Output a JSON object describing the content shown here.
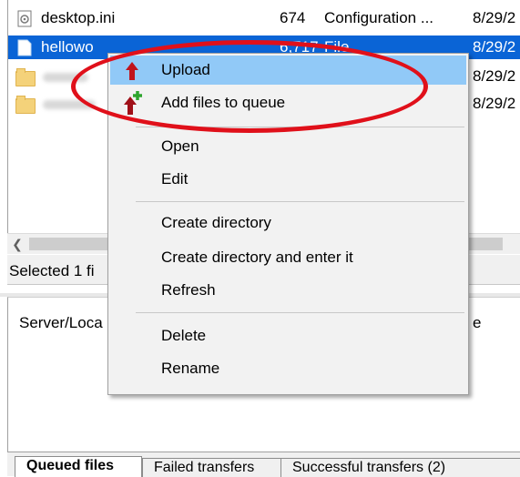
{
  "files": {
    "rows": [
      {
        "name": "desktop.ini",
        "size": "674",
        "type": "Configuration ...",
        "date": "8/29/2"
      },
      {
        "name": "hellowo",
        "size": "6,717",
        "type": "File",
        "date": "8/29/2"
      },
      {
        "name": "",
        "size": "",
        "type": "",
        "date": "8/29/2"
      },
      {
        "name": "",
        "size": "",
        "type": "",
        "date": "8/29/2"
      }
    ]
  },
  "status": {
    "text": "Selected 1 fi"
  },
  "queue": {
    "col_server": "Server/Loca",
    "col_e": "e"
  },
  "tabs": [
    "Queued files",
    "Failed transfers",
    "Successful transfers (2)"
  ],
  "menu": {
    "upload": "Upload",
    "add_queue": "Add files to queue",
    "open": "Open",
    "edit": "Edit",
    "create_dir": "Create directory",
    "create_dir_enter": "Create directory and enter it",
    "refresh": "Refresh",
    "delete": "Delete",
    "rename": "Rename"
  },
  "colors": {
    "selection": "#0a64d6",
    "menu_highlight": "#91c9f7",
    "annotation": "#e0101a",
    "upload_arrow": "#c0141c",
    "plus": "#2ea52e"
  }
}
